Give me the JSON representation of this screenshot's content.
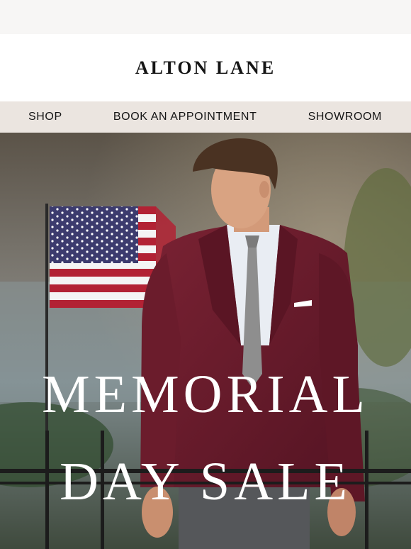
{
  "brand": {
    "name": "ALTON LANE"
  },
  "nav": {
    "items": [
      {
        "label": "SHOP"
      },
      {
        "label": "BOOK AN APPOINTMENT"
      },
      {
        "label": "SHOWROOM"
      }
    ]
  },
  "hero": {
    "title_line_1": "MEMORIAL",
    "title_line_2": "DAY SALE",
    "image_subject": "man-in-burgundy-suit-with-american-flag"
  },
  "colors": {
    "page_background": "#f7f6f5",
    "nav_background": "#ebe5e0",
    "suit": "#6f1b2c",
    "flag_red": "#b22234",
    "flag_blue": "#3c3b6e"
  }
}
